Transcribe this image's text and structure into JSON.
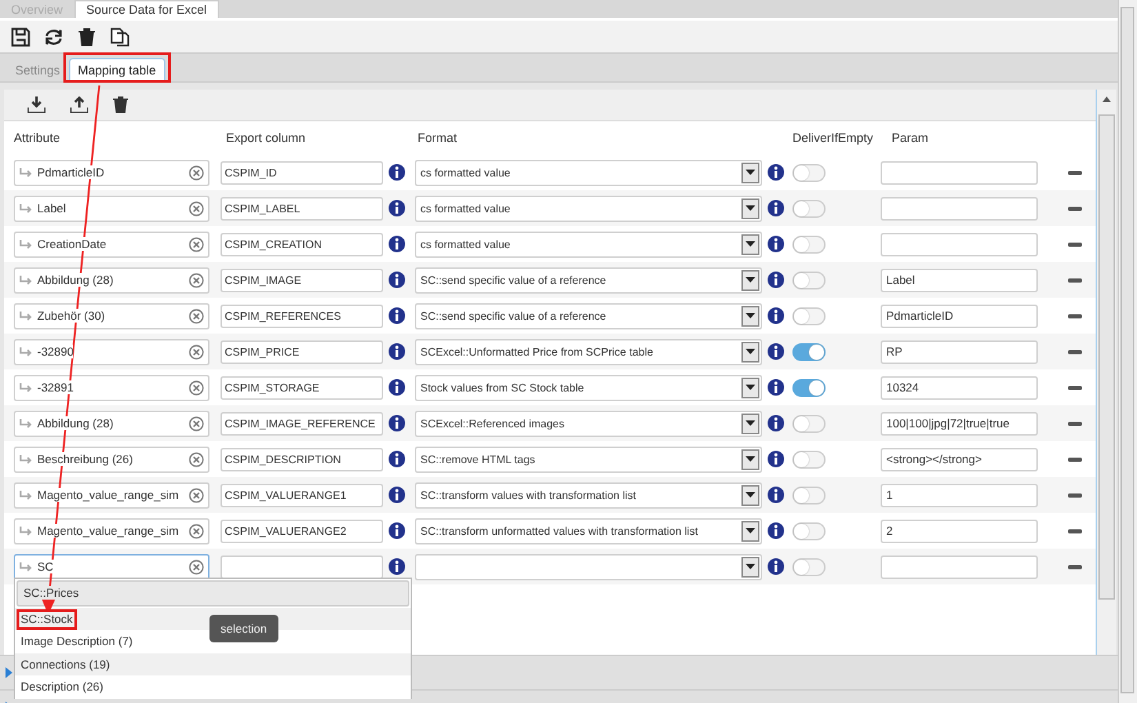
{
  "top_tabs": [
    {
      "label": "Overview",
      "selected": false
    },
    {
      "label": "Source Data for Excel",
      "selected": true
    }
  ],
  "sub_tabs": [
    {
      "label": "Settings",
      "selected": false
    },
    {
      "label": "Mapping table",
      "selected": true,
      "highlighted": true
    }
  ],
  "table": {
    "columns": [
      "Attribute",
      "Export column",
      "Format",
      "DeliverIfEmpty",
      "Param"
    ],
    "rows": [
      {
        "attribute": "PdmarticleID",
        "export": "CSPIM_ID",
        "format": "cs formatted value",
        "deliver_if_empty": false,
        "param": ""
      },
      {
        "attribute": "Label",
        "export": "CSPIM_LABEL",
        "format": "cs formatted value",
        "deliver_if_empty": false,
        "param": ""
      },
      {
        "attribute": "CreationDate",
        "export": "CSPIM_CREATION",
        "format": "cs formatted value",
        "deliver_if_empty": false,
        "param": ""
      },
      {
        "attribute": "Abbildung (28)",
        "export": "CSPIM_IMAGE",
        "format": "SC::send specific value of a reference",
        "deliver_if_empty": false,
        "param": "Label"
      },
      {
        "attribute": "Zubehör (30)",
        "export": "CSPIM_REFERENCES",
        "format": "SC::send specific value of a reference",
        "deliver_if_empty": false,
        "param": "PdmarticleID"
      },
      {
        "attribute": "-32890",
        "export": "CSPIM_PRICE",
        "format": "SCExcel::Unformatted Price from SCPrice table",
        "deliver_if_empty": true,
        "param": "RP"
      },
      {
        "attribute": "-32891",
        "export": "CSPIM_STORAGE",
        "format": "Stock values from SC Stock table",
        "deliver_if_empty": true,
        "param": "10324"
      },
      {
        "attribute": "Abbildung (28)",
        "export": "CSPIM_IMAGE_REFERENCE",
        "format": "SCExcel::Referenced images",
        "deliver_if_empty": false,
        "param": "100|100|jpg|72|true|true"
      },
      {
        "attribute": "Beschreibung (26)",
        "export": "CSPIM_DESCRIPTION",
        "format": "SC::remove HTML tags",
        "deliver_if_empty": false,
        "param": "<strong></strong>"
      },
      {
        "attribute": "Magento_value_range_sim",
        "export": "CSPIM_VALUERANGE1",
        "format": "SC::transform values with transformation list",
        "deliver_if_empty": false,
        "param": "1"
      },
      {
        "attribute": "Magento_value_range_sim",
        "export": "CSPIM_VALUERANGE2",
        "format": "SC::transform unformatted values with transformation list",
        "deliver_if_empty": false,
        "param": "2"
      },
      {
        "attribute": "SC",
        "export": "",
        "format": "",
        "deliver_if_empty": false,
        "param": "",
        "focused": true
      }
    ]
  },
  "suggestions": [
    {
      "label": "SC::Prices",
      "hovered": true,
      "highlighted": false
    },
    {
      "label": "SC::Stock",
      "hovered": false,
      "highlighted": true
    },
    {
      "label": "Image Description (7)",
      "hovered": false,
      "highlighted": false
    },
    {
      "label": "Connections (19)",
      "hovered": false,
      "highlighted": false
    },
    {
      "label": "Description (26)",
      "hovered": false,
      "highlighted": false
    }
  ],
  "tooltip": "selection"
}
